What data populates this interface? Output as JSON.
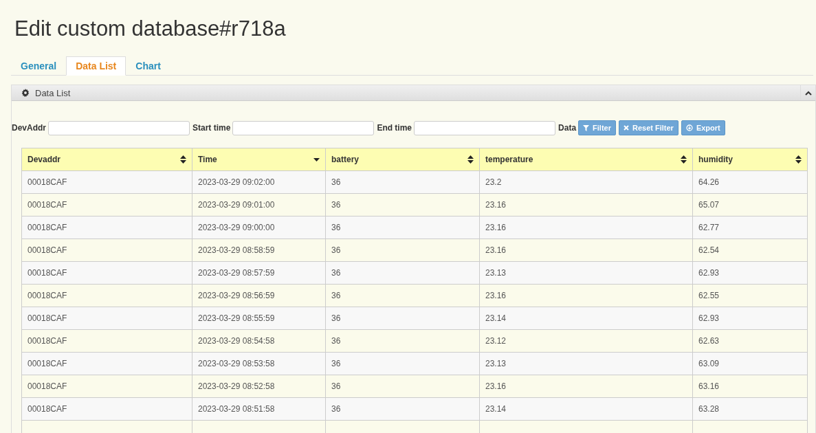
{
  "title": "Edit custom database#r718a",
  "tabs": [
    {
      "label": "General",
      "selected": false
    },
    {
      "label": "Data List",
      "selected": true
    },
    {
      "label": "Chart",
      "selected": false
    }
  ],
  "panel": {
    "title": "Data List",
    "expanded": true
  },
  "filters": [
    {
      "label": "DevAddr"
    },
    {
      "label": "Start time"
    },
    {
      "label": "End time"
    }
  ],
  "data_label": "Data",
  "buttons": [
    {
      "label": "Filter",
      "kind": "filter"
    },
    {
      "label": "Reset Filter",
      "kind": "reset"
    },
    {
      "label": "Export",
      "kind": "export"
    }
  ],
  "table": {
    "columns": [
      {
        "label": "Devaddr",
        "kind": "sortable"
      },
      {
        "label": "Time",
        "kind": "descending"
      },
      {
        "label": "battery",
        "kind": "sortable"
      },
      {
        "label": "temperature",
        "kind": "sortable"
      },
      {
        "label": "humidity",
        "kind": "sortable"
      }
    ],
    "rows": [
      [
        "00018CAF",
        "2023-03-29 09:02:00",
        "36",
        "23.2",
        "64.26"
      ],
      [
        "00018CAF",
        "2023-03-29 09:01:00",
        "36",
        "23.16",
        "65.07"
      ],
      [
        "00018CAF",
        "2023-03-29 09:00:00",
        "36",
        "23.16",
        "62.77"
      ],
      [
        "00018CAF",
        "2023-03-29 08:58:59",
        "36",
        "23.16",
        "62.54"
      ],
      [
        "00018CAF",
        "2023-03-29 08:57:59",
        "36",
        "23.13",
        "62.93"
      ],
      [
        "00018CAF",
        "2023-03-29 08:56:59",
        "36",
        "23.16",
        "62.55"
      ],
      [
        "00018CAF",
        "2023-03-29 08:55:59",
        "36",
        "23.14",
        "62.93"
      ],
      [
        "00018CAF",
        "2023-03-29 08:54:58",
        "36",
        "23.12",
        "62.63"
      ],
      [
        "00018CAF",
        "2023-03-29 08:53:58",
        "36",
        "23.13",
        "63.09"
      ],
      [
        "00018CAF",
        "2023-03-29 08:52:58",
        "36",
        "23.16",
        "63.16"
      ],
      [
        "00018CAF",
        "2023-03-29 08:51:58",
        "36",
        "23.14",
        "63.28"
      ]
    ]
  }
}
